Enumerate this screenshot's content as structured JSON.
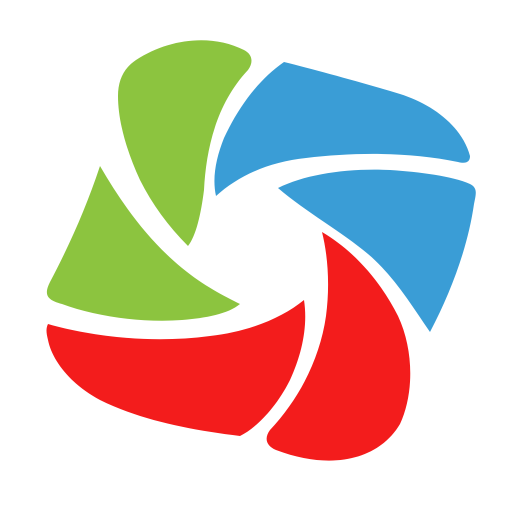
{
  "logo": {
    "icon": "pinwheel-logo-icon",
    "colors": {
      "green": "#8cc43f",
      "blue": "#3a9dd6",
      "red": "#f31c1c",
      "background": "#ffffff"
    }
  }
}
